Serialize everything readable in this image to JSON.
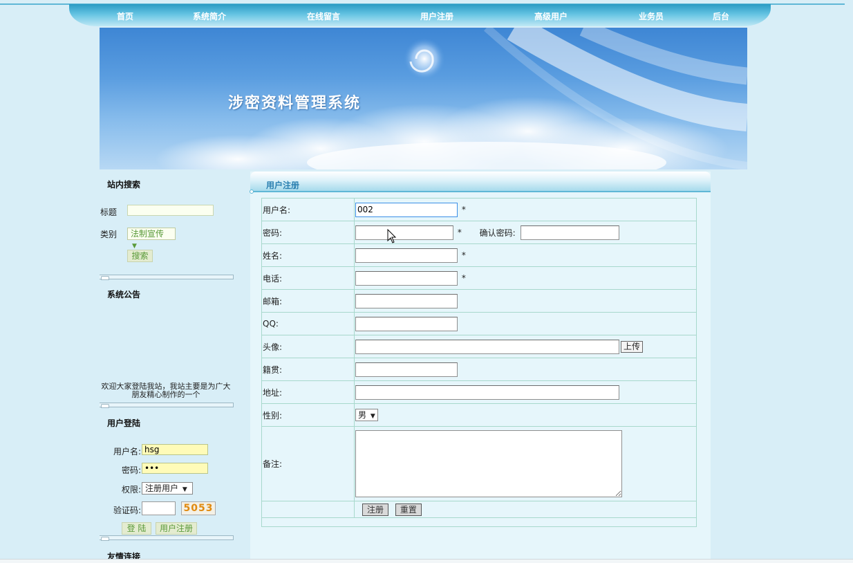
{
  "nav": {
    "items": [
      "首页",
      "系统简介",
      "在线留言",
      "用户注册",
      "高级用户",
      "业务员",
      "后台"
    ]
  },
  "banner": {
    "title": "涉密资料管理系统"
  },
  "sidebar": {
    "search": {
      "heading": "站内搜索",
      "title_label": "标题",
      "title_value": "",
      "category_label": "类别",
      "category_value": "法制宣传",
      "search_button": "搜索"
    },
    "notice": {
      "heading": "系统公告",
      "text": "欢迎大家登陆我站，我站主要是为广大朋友精心制作的一个"
    },
    "login": {
      "heading": "用户登陆",
      "username_label": "用户名:",
      "username_value": "hsg",
      "password_label": "密码:",
      "password_value": "•••",
      "role_label": "权限:",
      "role_value": "注册用户",
      "captcha_label": "验证码:",
      "captcha_value": "",
      "captcha_image": "5053",
      "login_button": "登 陆",
      "register_button": "用户注册"
    },
    "links": {
      "heading": "友情连接"
    }
  },
  "main": {
    "title": "用户注册",
    "form": {
      "username_label": "用户名:",
      "username_value": "002",
      "password_label": "密码:",
      "confirm_label": "确认密码:",
      "name_label": "姓名:",
      "phone_label": "电话:",
      "email_label": "邮箱:",
      "qq_label": "QQ:",
      "avatar_label": "头像:",
      "upload_button": "上传",
      "hometown_label": "籍贯:",
      "address_label": "地址:",
      "gender_label": "性别:",
      "gender_value": "男",
      "remark_label": "备注:",
      "required_mark": "*",
      "submit_button": "注册",
      "reset_button": "重置"
    }
  },
  "colors": {
    "page_bg": "#d8eef7",
    "nav": "#2a9bc4",
    "link_green": "#5a9a3a",
    "panel_bg": "#e6f6fb"
  }
}
